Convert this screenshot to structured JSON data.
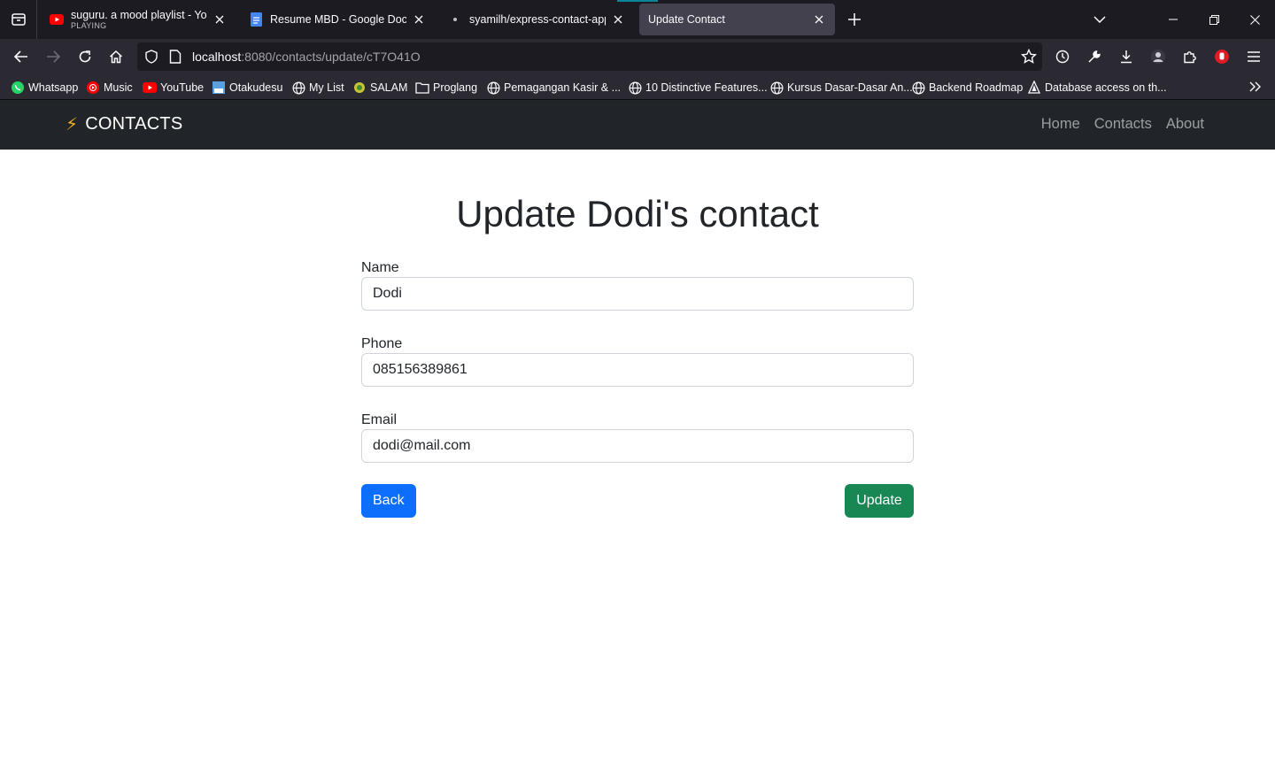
{
  "browser": {
    "tabs": [
      {
        "title": "suguru. a mood playlist - YouTube",
        "subtitle": "PLAYING",
        "icon": "youtube-icon",
        "active": false
      },
      {
        "title": "Resume MBD - Google Docs",
        "icon": "docs-icon",
        "active": false
      },
      {
        "title": "syamilh/express-contact-app: S",
        "icon": "github-icon",
        "active": false
      },
      {
        "title": "Update Contact",
        "icon": "",
        "active": true
      }
    ],
    "url_host": "localhost",
    "url_path": ":8080/contacts/update/cT7O41O",
    "bookmarks": [
      {
        "label": "Whatsapp",
        "icon": "whatsapp-icon"
      },
      {
        "label": "Music",
        "icon": "youtube-music-icon"
      },
      {
        "label": "YouTube",
        "icon": "youtube-icon"
      },
      {
        "label": "Otakudesu",
        "icon": "site-icon"
      },
      {
        "label": "My List",
        "icon": "globe-icon"
      },
      {
        "label": "SALAM",
        "icon": "site-icon"
      },
      {
        "label": "Proglang",
        "icon": "folder-icon"
      },
      {
        "label": "Pemagangan Kasir & ...",
        "icon": "globe-icon"
      },
      {
        "label": "10 Distinctive Features...",
        "icon": "globe-icon"
      },
      {
        "label": "Kursus Dasar-Dasar An...",
        "icon": "globe-icon"
      },
      {
        "label": "Backend Roadmap",
        "icon": "globe-icon"
      },
      {
        "label": "Database access on th...",
        "icon": "site-icon"
      }
    ]
  },
  "site": {
    "brand": "CONTACTS",
    "nav": [
      "Home",
      "Contacts",
      "About"
    ]
  },
  "form": {
    "title": "Update Dodi's contact",
    "name_label": "Name",
    "name_value": "Dodi",
    "phone_label": "Phone",
    "phone_value": "085156389861",
    "email_label": "Email",
    "email_value": "dodi@mail.com",
    "back_label": "Back",
    "update_label": "Update"
  },
  "colors": {
    "navbar": "#212529",
    "primary": "#0d6efd",
    "success": "#198754"
  }
}
